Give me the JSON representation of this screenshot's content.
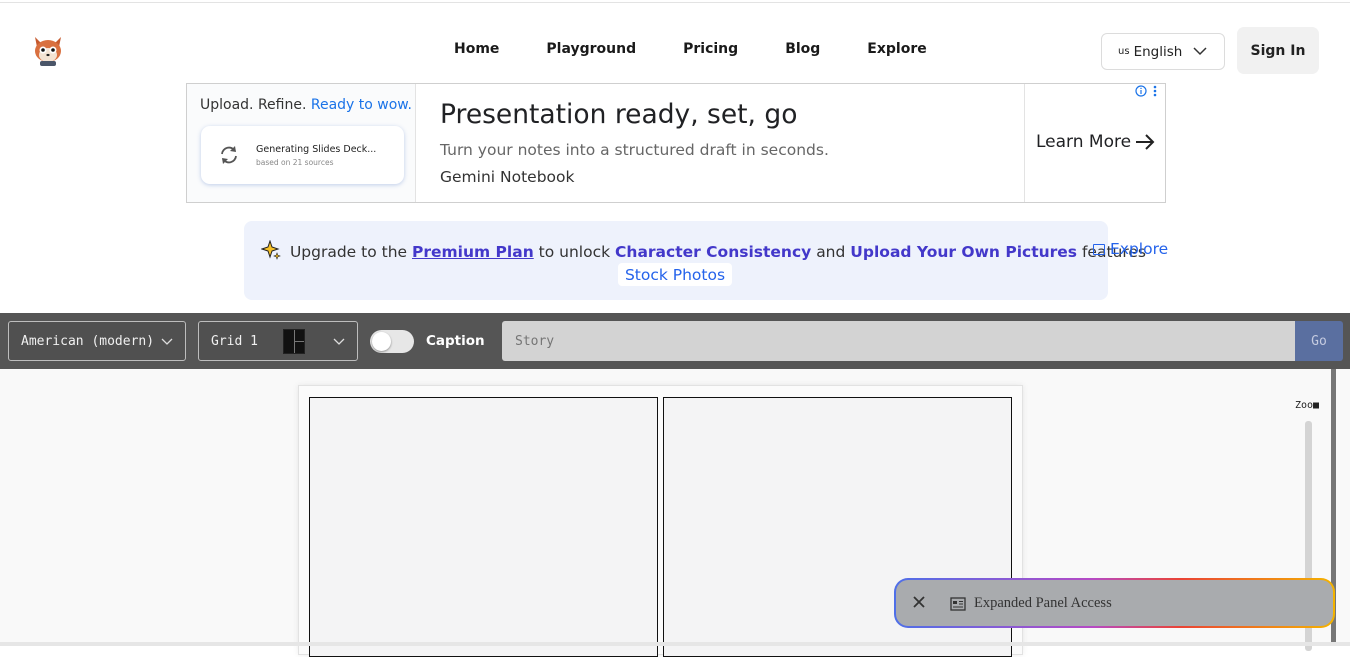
{
  "header": {
    "nav": [
      "Home",
      "Playground",
      "Pricing",
      "Blog",
      "Explore"
    ],
    "language": {
      "flag": "us",
      "label": "English"
    },
    "sign_in": "Sign In"
  },
  "ad": {
    "left_head_plain": "Upload. Refine.",
    "left_head_blue": "Ready to wow.",
    "card_title": "Generating Slides Deck...",
    "card_sub": "based on 21 sources",
    "title": "Presentation ready, set, go",
    "subtitle": "Turn your notes into a structured draft in seconds.",
    "brand": "Gemini Notebook",
    "cta": "Learn More"
  },
  "banner": {
    "prefix": "Upgrade to the",
    "premium": "Premium Plan",
    "mid1": "to unlock",
    "feature1": "Character Consistency",
    "mid2": "and",
    "feature2": "Upload Your Own Pictures",
    "suffix": "features",
    "explore_top": "Explore",
    "explore_bottom": "Stock Photos"
  },
  "toolbar": {
    "style_value": "American (modern)",
    "grid_value": "Grid 1",
    "caption_label": "Caption",
    "caption_on": false,
    "story_placeholder": "Story",
    "go_label": "Go"
  },
  "canvas": {
    "zoom_label": "Zoo■"
  },
  "floating": {
    "label": "Expanded Panel Access"
  }
}
